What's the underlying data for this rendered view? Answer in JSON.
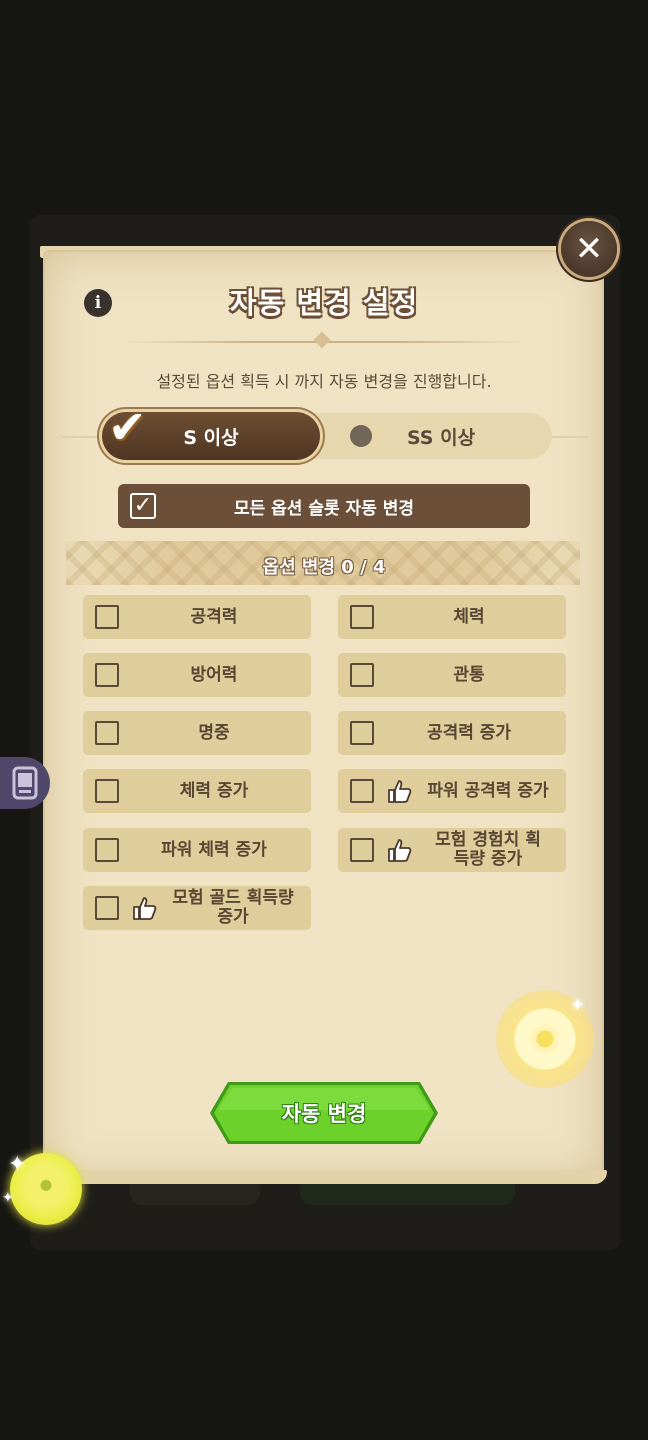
{
  "dialog": {
    "title": "자동 변경 설정",
    "subtitle": "설정된 옵션 획득 시 까지 자동 변경을 진행합니다.",
    "close_symbol": "✕",
    "info_symbol": "i"
  },
  "grade_toggle": {
    "selected": "S 이상",
    "s_label": "S 이상",
    "ss_label": "SS 이상",
    "check_symbol": "✔"
  },
  "all_slots": {
    "label": "모든 옵션 슬롯 자동 변경",
    "checked": true,
    "check_symbol": "✓"
  },
  "options_header": {
    "label": "옵션 변경 0 / 4"
  },
  "options": [
    {
      "label": "공격력",
      "recommended": false,
      "checked": false
    },
    {
      "label": "체력",
      "recommended": false,
      "checked": false
    },
    {
      "label": "방어력",
      "recommended": false,
      "checked": false
    },
    {
      "label": "관통",
      "recommended": false,
      "checked": false
    },
    {
      "label": "명중",
      "recommended": false,
      "checked": false
    },
    {
      "label": "공격력 증가",
      "recommended": false,
      "checked": false
    },
    {
      "label": "체력 증가",
      "recommended": false,
      "checked": false
    },
    {
      "label": "파워 공격력 증가",
      "recommended": true,
      "checked": false
    },
    {
      "label": "파워 체력 증가",
      "recommended": false,
      "checked": false
    },
    {
      "label": "모험 경험치 획득량 증가",
      "recommended": true,
      "checked": false
    },
    {
      "label": "모험 골드 획득량 증가",
      "recommended": true,
      "checked": false
    }
  ],
  "actions": {
    "auto_change_label": "자동 변경"
  },
  "icons": {
    "info": "info-icon",
    "close": "close-icon",
    "thumbs_up": "thumbs-up-icon",
    "side_menu": "device-icon"
  },
  "colors": {
    "panel": "#efe3c3",
    "brown_accent": "#6b4f38",
    "green_button": "#5ccc1e",
    "option_bg": "#e0cd9c"
  }
}
